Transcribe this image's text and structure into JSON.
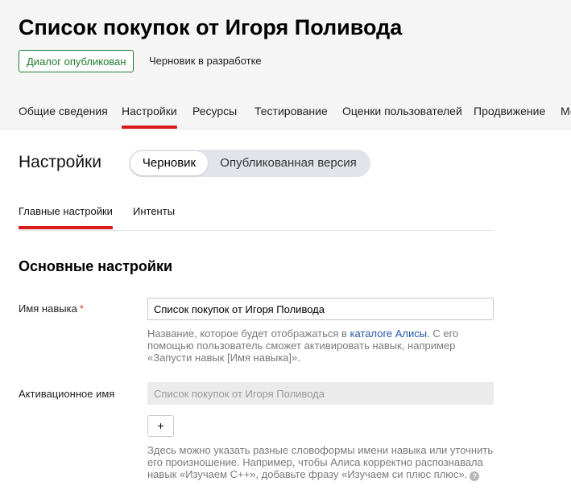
{
  "header": {
    "title": "Список покупок от Игоря Поливода",
    "status_badge": "Диалог опубликован",
    "draft_status": "Черновик в разработке",
    "tabs": [
      {
        "label": "Общие сведения"
      },
      {
        "label": "Настройки"
      },
      {
        "label": "Ресурсы"
      },
      {
        "label": "Тестирование"
      },
      {
        "label": "Оценки пользователей"
      },
      {
        "label": "Продвижение"
      },
      {
        "label": "Мо"
      }
    ],
    "active_tab": "Настройки"
  },
  "settings": {
    "title": "Настройки",
    "version_switch": {
      "options": [
        "Черновик",
        "Опубликованная версия"
      ],
      "selected": "Черновик"
    },
    "sub_tabs": [
      {
        "label": "Главные настройки"
      },
      {
        "label": "Интенты"
      }
    ],
    "active_sub_tab": "Главные настройки"
  },
  "form": {
    "section_title": "Основные настройки",
    "skill_name": {
      "label": "Имя навыка",
      "required_mark": "*",
      "value": "Список покупок от Игоря Поливода",
      "hint_before": "Название, которое будет отображаться в ",
      "hint_link": "каталоге Алисы",
      "hint_after": ". С его помощью пользователь сможет активировать навык, например «Запусти навык [Имя навыка]»."
    },
    "activation_name": {
      "label": "Активационное имя",
      "placeholder": "Список покупок от Игоря Поливода",
      "add_button": "+",
      "hint": "Здесь можно указать разные словоформы имени навыка или уточнить его произношение. Например, чтобы Алиса корректно распознавала навык «Изучаем С++», добавьте фразу «Изучаем си плюс плюс».",
      "help_icon": "?"
    }
  },
  "colors": {
    "accent": "#d81b1b",
    "badge_green": "#1f7a2d",
    "link": "#2256a8",
    "required": "#e0392b",
    "header_bg": "#f5f5f6"
  }
}
